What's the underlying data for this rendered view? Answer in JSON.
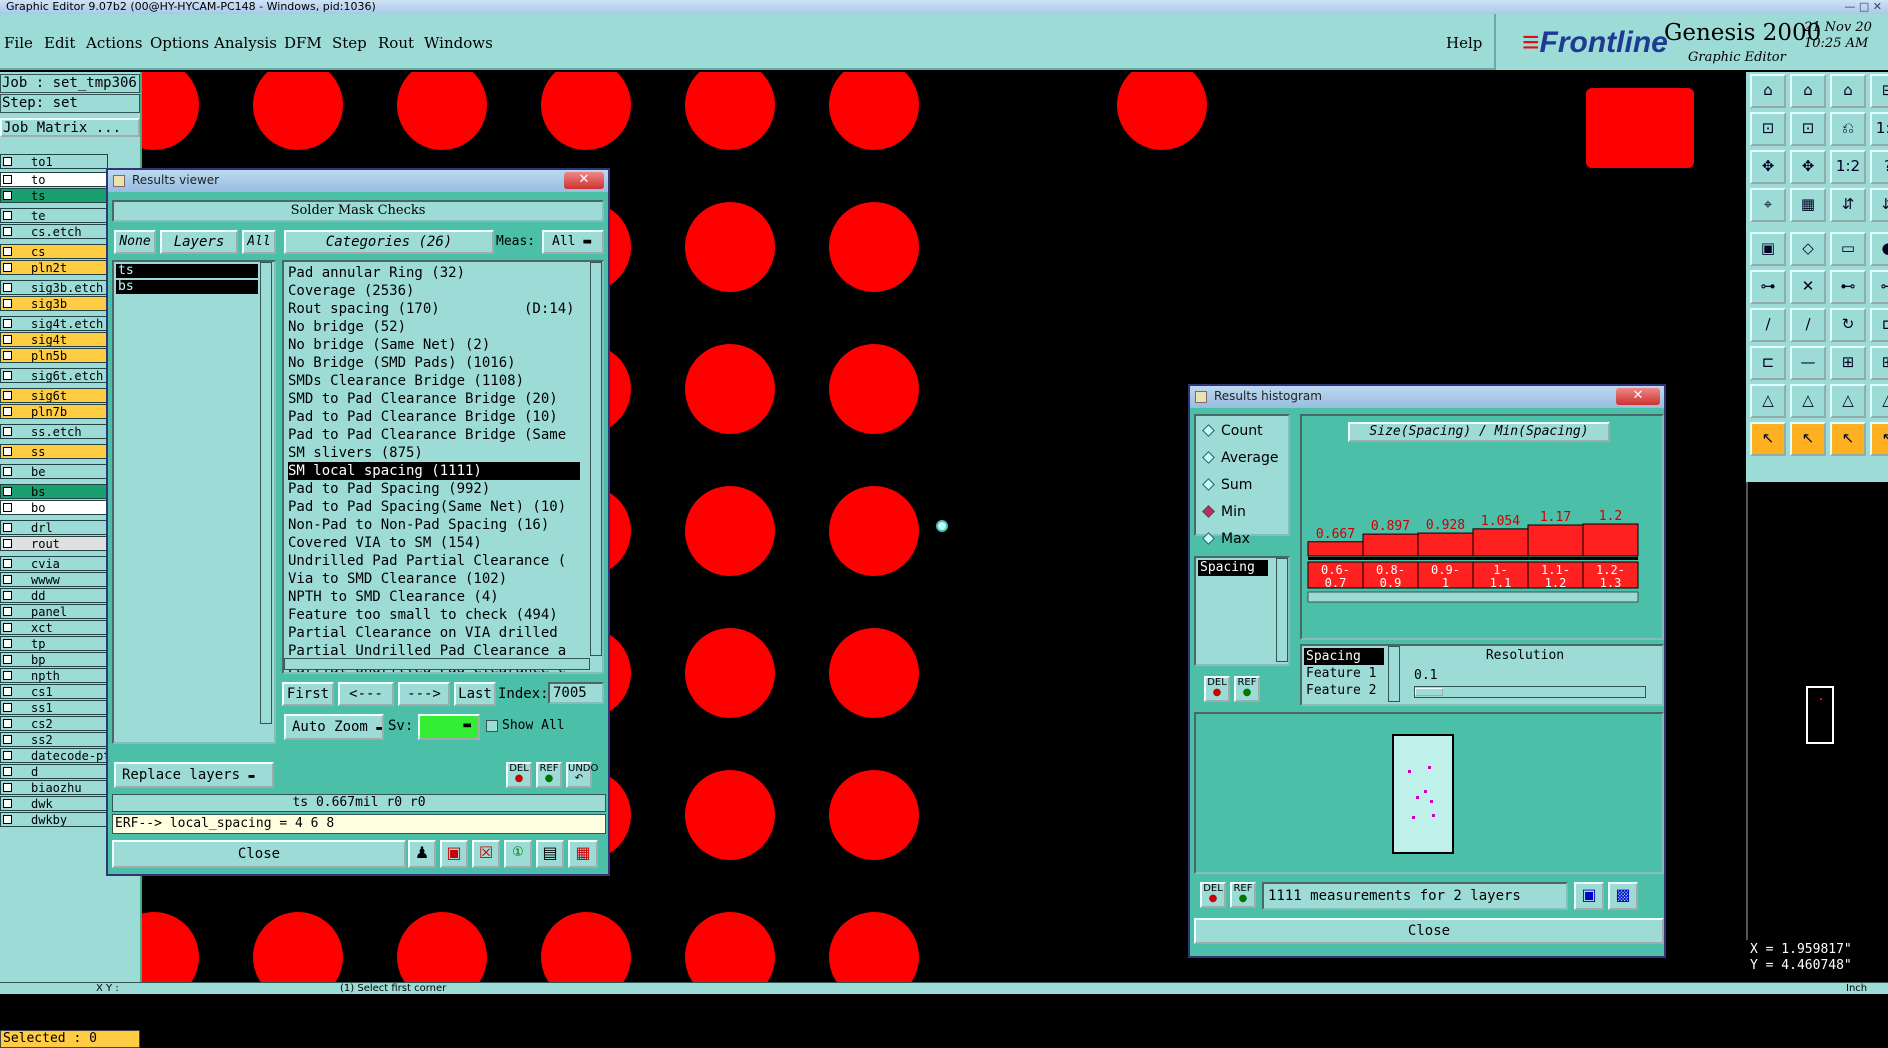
{
  "window": {
    "title": "Graphic Editor 9.07b2 (00@HY-HYCAM-PC148 - Windows, pid:1036)"
  },
  "menubar": {
    "items": [
      "File",
      "Edit",
      "Actions",
      "Options",
      "Analysis",
      "DFM",
      "Step",
      "Rout",
      "Windows"
    ],
    "help": "Help"
  },
  "logo": {
    "brand": "Frontline",
    "product": "Genesis 2000",
    "subtitle": "Graphic Editor",
    "datetime": "21 Nov 20\n10:25 AM"
  },
  "left": {
    "job": "Job : set_tmp306",
    "step": "Step: set",
    "job_matrix": "Job Matrix ...",
    "layers": [
      {
        "name": "to1",
        "color": "#9ddbd7"
      },
      {
        "name": "to",
        "color": "#ffffff"
      },
      {
        "name": "ts",
        "color": "#1aa06f"
      },
      {
        "name": "te",
        "color": "#9ddbd7"
      },
      {
        "name": "cs.etch",
        "color": "#9ddbd7"
      },
      {
        "name": "cs",
        "color": "#ffcc44"
      },
      {
        "name": "pln2t",
        "color": "#ffcc44"
      },
      {
        "name": "sig3b.etch",
        "color": "#9ddbd7"
      },
      {
        "name": "sig3b",
        "color": "#ffcc44"
      },
      {
        "name": "sig4t.etch",
        "color": "#9ddbd7"
      },
      {
        "name": "sig4t",
        "color": "#ffcc44"
      },
      {
        "name": "pln5b",
        "color": "#ffcc44"
      },
      {
        "name": "sig6t.etch",
        "color": "#9ddbd7"
      },
      {
        "name": "sig6t",
        "color": "#ffcc44"
      },
      {
        "name": "pln7b",
        "color": "#ffcc44"
      },
      {
        "name": "ss.etch",
        "color": "#9ddbd7"
      },
      {
        "name": "ss",
        "color": "#ffcc44"
      },
      {
        "name": "be",
        "color": "#9ddbd7"
      },
      {
        "name": "bs",
        "color": "#1aa06f"
      },
      {
        "name": "bo",
        "color": "#ffffff"
      },
      {
        "name": "drl",
        "color": "#9ddbd7"
      },
      {
        "name": "rout",
        "color": "#e0e0e0"
      },
      {
        "name": "cvia",
        "color": "#9ddbd7"
      },
      {
        "name": "wwww",
        "color": "#9ddbd7"
      },
      {
        "name": "dd",
        "color": "#9ddbd7"
      },
      {
        "name": "panel",
        "color": "#9ddbd7"
      },
      {
        "name": "xct",
        "color": "#9ddbd7"
      },
      {
        "name": "tp",
        "color": "#9ddbd7"
      },
      {
        "name": "bp",
        "color": "#9ddbd7"
      },
      {
        "name": "npth",
        "color": "#9ddbd7"
      },
      {
        "name": "cs1",
        "color": "#9ddbd7"
      },
      {
        "name": "ss1",
        "color": "#9ddbd7"
      },
      {
        "name": "cs2",
        "color": "#9ddbd7"
      },
      {
        "name": "ss2",
        "color": "#9ddbd7"
      },
      {
        "name": "datecode-pth",
        "color": "#9ddbd7"
      },
      {
        "name": "d",
        "color": "#9ddbd7"
      },
      {
        "name": "biaozhu",
        "color": "#9ddbd7"
      },
      {
        "name": "dwk",
        "color": "#9ddbd7"
      },
      {
        "name": "dwkby",
        "color": "#9ddbd7"
      }
    ],
    "selected": "Selected : 0"
  },
  "results_viewer": {
    "title": "Results viewer",
    "heading": "Solder Mask Checks",
    "none": "None",
    "layers": "Layers",
    "all": "All",
    "categories_label": "Categories (26)",
    "meas_label": "Meas:",
    "meas_value": "All",
    "layer_list": [
      "ts",
      "bs"
    ],
    "categories": [
      "Pad annular Ring (32)",
      "Coverage (2536)",
      "Rout spacing (170)          (D:14)",
      "No bridge (52)",
      "No bridge (Same Net) (2)",
      "No Bridge (SMD Pads) (1016)",
      "SMDs Clearance Bridge (1108)",
      "SMD to Pad Clearance Bridge (20)",
      "Pad to Pad Clearance Bridge (10)",
      "Pad to Pad Clearance Bridge (Same",
      "SM slivers (875)",
      "SM local spacing (1111)",
      "Pad to Pad Spacing (992)",
      "Pad to Pad Spacing(Same Net) (10)",
      "Non-Pad to Non-Pad Spacing (16)",
      "Covered VIA to SM (154)",
      "Undrilled Pad Partial Clearance (",
      "Via to SMD Clearance (102)",
      "NPTH to SMD Clearance (4)",
      "Feature too small to check (494)",
      "Partial Clearance on VIA drilled",
      "Partial Undrilled Pad Clearance a",
      "Partial Undrilled Pad Clearance c"
    ],
    "selected_index": 11,
    "nav": {
      "first": "First",
      "prev": "<---",
      "next": "--->",
      "last": "Last",
      "index_label": "Index:",
      "index_value": "7005"
    },
    "auto_zoom": "Auto Zoom",
    "sv_label": "Sv:",
    "show_all": "Show All",
    "replace_layers": "Replace layers",
    "icons": {
      "del": "DEL",
      "ref": "REF",
      "undo": "UNDO"
    },
    "info_line": "ts 0.667mil  r0  r0",
    "erf_line": "ERF--> local_spacing = 4 6 8",
    "close": "Close"
  },
  "histogram": {
    "title": "Results histogram",
    "modes": [
      "Count",
      "Average",
      "Sum",
      "Min",
      "Max"
    ],
    "selected_mode": "Min",
    "chart_title": "Size(Spacing) / Min(Spacing)",
    "list_items": [
      "Spacing"
    ],
    "size_list": [
      "Spacing",
      "Feature 1",
      "Feature 2"
    ],
    "resolution_label": "Resolution",
    "resolution_value": "0.1",
    "footer": "1111 measurements for 2 layers",
    "close": "Close",
    "icons": {
      "del": "DEL",
      "ref": "REF"
    },
    "chart_data": {
      "type": "bar",
      "title": "Size(Spacing) / Min(Spacing)",
      "categories": [
        "0.6-\n0.7",
        "0.8-\n0.9",
        "0.9-\n1",
        "1-\n1.1",
        "1.1-\n1.2",
        "1.2-\n1.3"
      ],
      "values": [
        0.667,
        0.897,
        0.928,
        1.054,
        1.17,
        1.2
      ],
      "value_labels": [
        "0.667",
        "0.897",
        "0.928",
        "1.054",
        "1.17",
        "1.2"
      ]
    }
  },
  "coords": {
    "x": "X = 1.959817\"",
    "y": "Y = 4.460748\""
  },
  "status": {
    "left": "X Y :",
    "prompt": "(1)  Select first corner",
    "right": "Inch"
  },
  "colors": {
    "panel": "#9ddbd7",
    "dialog": "#4cbfa8",
    "pad": "#ff0000",
    "canvas": "#000000"
  }
}
